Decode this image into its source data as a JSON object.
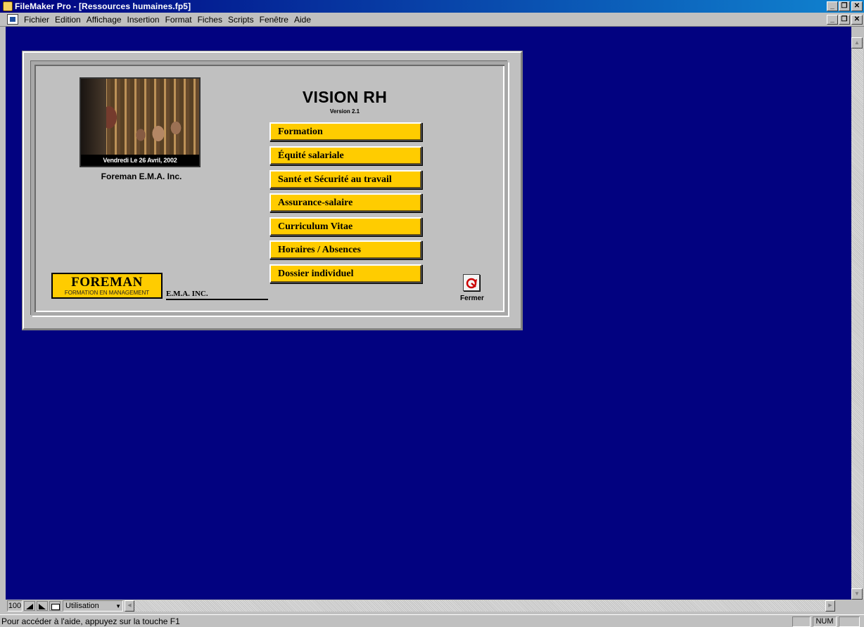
{
  "titlebar": {
    "title": "FileMaker Pro - [Ressources humaines.fp5]",
    "buttons": {
      "minimize": "_",
      "restore": "❐",
      "close": "✕"
    }
  },
  "menubar": {
    "items": [
      {
        "label": "Fichier"
      },
      {
        "label": "Edition"
      },
      {
        "label": "Affichage"
      },
      {
        "label": "Insertion"
      },
      {
        "label": "Format"
      },
      {
        "label": "Fiches"
      },
      {
        "label": "Scripts"
      },
      {
        "label": "Fenêtre"
      },
      {
        "label": "Aide"
      }
    ]
  },
  "layout": {
    "photo_caption": "Vendredi Le 26 Avril, 2002",
    "company_name": "Foreman E.M.A. Inc.",
    "app_title": "VISION RH",
    "version": "Version 2.1",
    "nav_buttons": [
      "Formation",
      "Équité salariale",
      "Santé et Sécurité au travail",
      "Assurance-salaire",
      "Curriculum Vitae",
      "Horaires / Absences",
      "Dossier individuel"
    ],
    "logo": {
      "name": "FOREMAN",
      "tagline": "FORMATION EN MANAGEMENT",
      "suffix": "E.M.A. INC."
    },
    "close_label": "Fermer"
  },
  "toolbar": {
    "zoom": "100",
    "mode": "Utilisation"
  },
  "statusbar": {
    "message": "Pour accéder à l'aide, appuyez sur la touche F1",
    "num": "NUM"
  },
  "colors": {
    "workspace": "#020280",
    "button": "#ffcc00",
    "titlebar": "#000080"
  }
}
